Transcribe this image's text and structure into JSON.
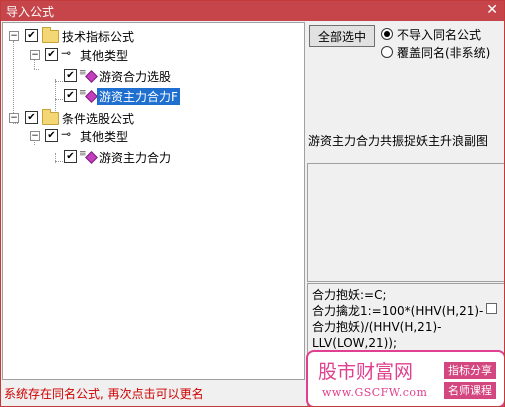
{
  "window": {
    "title": "导入公式",
    "close_icon": "close-icon"
  },
  "tree": {
    "group1": {
      "label": "技术指标公式",
      "expander": "−",
      "checked": "✔"
    },
    "group1_sub": {
      "label": "其他类型",
      "expander": "−",
      "checked": "✔"
    },
    "item1": {
      "label": "游资合力选股",
      "checked": "✔"
    },
    "item2": {
      "label": "游资主力合力F",
      "checked": "✔",
      "selected": true
    },
    "group2": {
      "label": "条件选股公式",
      "expander": "−",
      "checked": "✔"
    },
    "group2_sub": {
      "label": "其他类型",
      "expander": "−",
      "checked": "✔"
    },
    "item3": {
      "label": "游资主力合力",
      "checked": "✔"
    }
  },
  "options": {
    "select_all_label": "全部选中",
    "radio_no_import": "不导入同名公式",
    "radio_overwrite": "覆盖同名(非系统)",
    "selected_option": "不导入同名公式"
  },
  "description": "游资主力合力共振捉妖主升浪副图",
  "code_text": "合力抱妖:=C;\n合力擒龙1:=100*(HHV(H,21)-合力抱妖)/(HHV(H,21)-LLV(LOW,21));",
  "status_message": "系统存在同名公式, 再次点击可以更名",
  "watermark": {
    "brand": "股市财富网",
    "url": "www.GSCFW.com",
    "tag1": "指标分享",
    "tag2": "名师课程"
  },
  "colors": {
    "titlebar": "#c6454a",
    "selection": "#1f6fd1",
    "status_text": "#d00000",
    "watermark": "#e0408f"
  }
}
